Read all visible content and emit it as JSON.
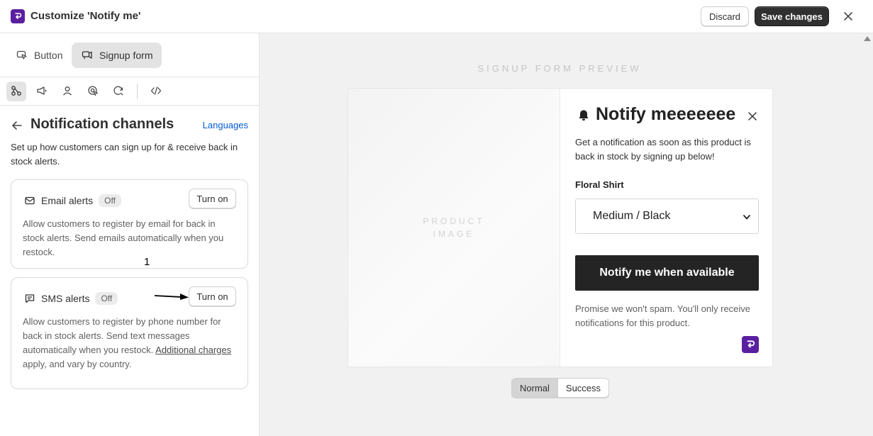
{
  "topbar": {
    "title": "Customize 'Notify me'",
    "discard_label": "Discard",
    "save_label": "Save changes"
  },
  "mode_tabs": [
    {
      "label": "Button",
      "icon": "cursor-click-icon",
      "active": false
    },
    {
      "label": "Signup form",
      "icon": "megaphone-form-icon",
      "active": true
    }
  ],
  "icon_row": [
    {
      "icon": "channels-icon",
      "active": true
    },
    {
      "icon": "megaphone-icon",
      "active": false
    },
    {
      "icon": "person-icon",
      "active": false
    },
    {
      "icon": "target-cursor-icon",
      "active": false
    },
    {
      "icon": "refresh-tag-icon",
      "active": false
    },
    {
      "icon": "code-icon",
      "active": false
    }
  ],
  "panel": {
    "title": "Notification channels",
    "languages_link": "Languages",
    "description": "Set up how customers can sign up for & receive back in stock alerts."
  },
  "channels": {
    "email": {
      "label": "Email alerts",
      "status": "Off",
      "action": "Turn on",
      "description": "Allow customers to register by email for back in stock alerts. Send emails automatically when you restock."
    },
    "sms": {
      "label": "SMS alerts",
      "status": "Off",
      "action": "Turn on",
      "description_pre": "Allow customers to register by phone number for back in stock alerts. Send text messages automatically when you restock. ",
      "description_link": "Additional charges",
      "description_post": " apply, and vary by country."
    }
  },
  "annotation": {
    "number": "1"
  },
  "preview": {
    "label": "SIGNUP FORM PREVIEW",
    "product_image_placeholder_1": "PRODUCT",
    "product_image_placeholder_2": "IMAGE",
    "form_title": "Notify meeeeeee",
    "form_description": "Get a notification as soon as this product is back in stock by signing up below!",
    "product_name": "Floral Shirt",
    "variant_selected": "Medium / Black",
    "notify_button": "Notify me when available",
    "spam_note": "Promise we won't spam. You'll only receive notifications for this product.",
    "state_options": [
      "Normal",
      "Success"
    ],
    "state_active": "Normal"
  },
  "colors": {
    "brand": "#5a1fa0",
    "primary_button": "#303030",
    "link": "#005bd3",
    "notify_button": "#242424"
  }
}
